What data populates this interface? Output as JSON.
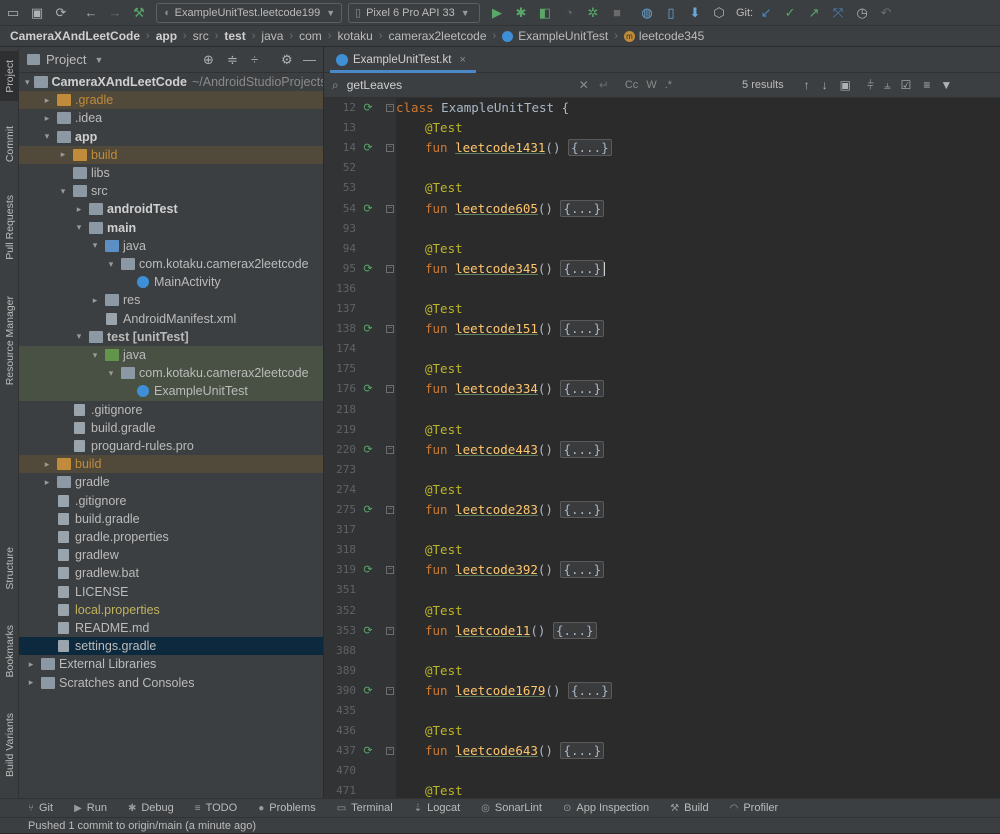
{
  "toolbar": {
    "run_config": "ExampleUnitTest.leetcode199",
    "device": "Pixel 6 Pro API 33",
    "git_label": "Git:"
  },
  "navbar": {
    "crumbs": [
      "CameraXAndLeetCode",
      "app",
      "src",
      "test",
      "java",
      "com",
      "kotaku",
      "camerax2leetcode",
      "ExampleUnitTest",
      "leetcode345"
    ]
  },
  "left_strip": {
    "tabs": [
      "Project",
      "Commit",
      "Pull Requests",
      "Resource Manager",
      "Structure",
      "Bookmarks",
      "Build Variants"
    ]
  },
  "project": {
    "title": "Project",
    "root_name": "CameraXAndLeetCode",
    "root_path": "~/AndroidStudioProjects",
    "items": [
      {
        "label": ".gradle"
      },
      {
        "label": ".idea"
      },
      {
        "label": "app"
      },
      {
        "label": "build"
      },
      {
        "label": "libs"
      },
      {
        "label": "src"
      },
      {
        "label": "androidTest"
      },
      {
        "label": "main"
      },
      {
        "label": "java"
      },
      {
        "label": "com.kotaku.camerax2leetcode"
      },
      {
        "label": "MainActivity"
      },
      {
        "label": "res"
      },
      {
        "label": "AndroidManifest.xml"
      },
      {
        "label": "test [unitTest]"
      },
      {
        "label": "java"
      },
      {
        "label": "com.kotaku.camerax2leetcode"
      },
      {
        "label": "ExampleUnitTest"
      },
      {
        "label": ".gitignore"
      },
      {
        "label": "build.gradle"
      },
      {
        "label": "proguard-rules.pro"
      },
      {
        "label": "build"
      },
      {
        "label": "gradle"
      },
      {
        "label": ".gitignore"
      },
      {
        "label": "build.gradle"
      },
      {
        "label": "gradle.properties"
      },
      {
        "label": "gradlew"
      },
      {
        "label": "gradlew.bat"
      },
      {
        "label": "LICENSE"
      },
      {
        "label": "local.properties"
      },
      {
        "label": "README.md"
      },
      {
        "label": "settings.gradle"
      },
      {
        "label": "External Libraries"
      },
      {
        "label": "Scratches and Consoles"
      }
    ]
  },
  "editor": {
    "tab_label": "ExampleUnitTest.kt",
    "search_query": "getLeaves",
    "search_results": "5 results",
    "class_line": {
      "num": "12",
      "kw": "class",
      "name": "ExampleUnitTest",
      "brace": "{"
    },
    "annotation": "@Test",
    "fun_kw": "fun",
    "folded": "{...}",
    "functions": [
      {
        "ann_line": "13",
        "fun_line": "14",
        "name": "leetcode1431",
        "end_line": "52"
      },
      {
        "ann_line": "53",
        "fun_line": "54",
        "name": "leetcode605",
        "end_line": "93"
      },
      {
        "ann_line": "94",
        "fun_line": "95",
        "name": "leetcode345",
        "end_line": "136"
      },
      {
        "ann_line": "137",
        "fun_line": "138",
        "name": "leetcode151",
        "end_line": "174"
      },
      {
        "ann_line": "175",
        "fun_line": "176",
        "name": "leetcode334",
        "end_line": "218"
      },
      {
        "ann_line": "219",
        "fun_line": "220",
        "name": "leetcode443",
        "end_line": "273"
      },
      {
        "ann_line": "274",
        "fun_line": "275",
        "name": "leetcode283",
        "end_line": "317"
      },
      {
        "ann_line": "318",
        "fun_line": "319",
        "name": "leetcode392",
        "end_line": "351"
      },
      {
        "ann_line": "352",
        "fun_line": "353",
        "name": "leetcode11",
        "end_line": "388"
      },
      {
        "ann_line": "389",
        "fun_line": "390",
        "name": "leetcode1679",
        "end_line": "435"
      },
      {
        "ann_line": "436",
        "fun_line": "437",
        "name": "leetcode643",
        "end_line": "470"
      },
      {
        "ann_line": "471",
        "fun_line": "",
        "name": "",
        "end_line": ""
      }
    ]
  },
  "bottom_tabs": [
    "Git",
    "Run",
    "Debug",
    "TODO",
    "Problems",
    "Terminal",
    "Logcat",
    "SonarLint",
    "App Inspection",
    "Build",
    "Profiler"
  ],
  "status": "Pushed 1 commit to origin/main (a minute ago)"
}
